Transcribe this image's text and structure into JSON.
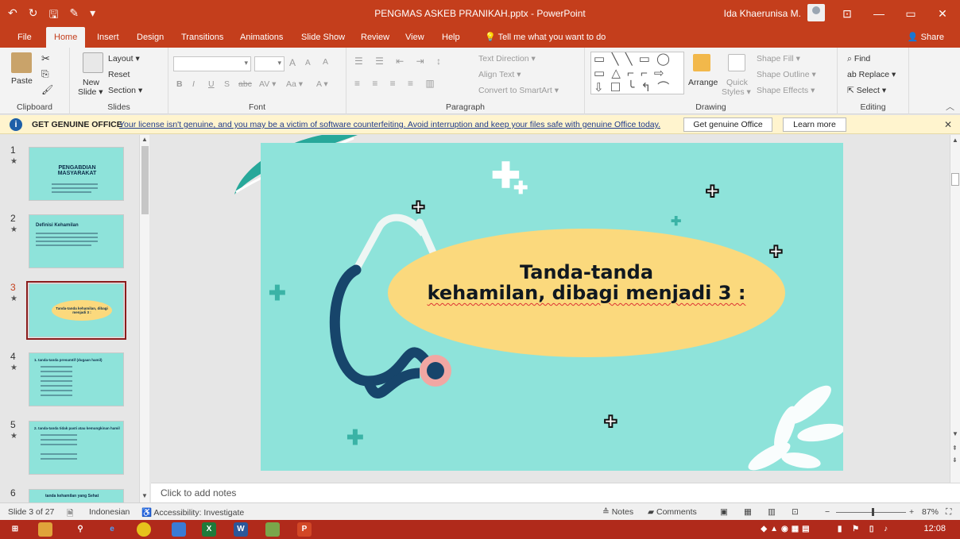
{
  "window": {
    "doc_title": "PENGMAS ASKEB PRANIKAH.pptx - PowerPoint",
    "user_name": "Ida Khaerunisa M.",
    "controls": {
      "minimize": "—",
      "restore": "▭",
      "close": "✕",
      "ribbon_display": "⊡"
    }
  },
  "qat": {
    "undo": "↶",
    "redo": "↻",
    "save": "🖫",
    "touch": "✎",
    "customize": "▾"
  },
  "tabs": [
    "File",
    "Home",
    "Insert",
    "Design",
    "Transitions",
    "Animations",
    "Slide Show",
    "Review",
    "View",
    "Help"
  ],
  "active_tab": "Home",
  "tell_me": "Tell me what you want to do",
  "share": "Share",
  "ribbon": {
    "clipboard": {
      "label": "Clipboard",
      "paste": "Paste"
    },
    "slides": {
      "label": "Slides",
      "new_slide": "New",
      "new_slide2": "Slide ▾",
      "layout": "Layout ▾",
      "reset": "Reset",
      "section": "Section ▾"
    },
    "font": {
      "label": "Font",
      "grow": "A",
      "shrink": "A",
      "clear": "A",
      "bold": "B",
      "italic": "I",
      "underline": "U",
      "shadow": "S",
      "strike": "abc",
      "spacing": "AV ▾",
      "case": "Aa ▾",
      "color": "A ▾"
    },
    "paragraph": {
      "label": "Paragraph",
      "text_direction": "Text Direction ▾",
      "align_text": "Align Text ▾",
      "smartart": "Convert to SmartArt ▾"
    },
    "drawing": {
      "label": "Drawing",
      "shapes": "▭ ╲ ╲ ▭ ◯ ▭ △ ⌐ ⌐ ⇨ ⇩ ☐ ╰ ↰ ⌒ { } ☆",
      "arrange": "Arrange",
      "quick_styles": "Quick",
      "quick_styles2": "Styles ▾",
      "shape_fill": "Shape Fill ▾",
      "shape_outline": "Shape Outline ▾",
      "shape_effects": "Shape Effects ▾"
    },
    "editing": {
      "label": "Editing",
      "find": "Find",
      "replace": "Replace ▾",
      "select": "Select ▾"
    }
  },
  "infobar": {
    "title": "GET GENUINE OFFICE",
    "message": "Your license isn't genuine, and you may be a victim of software counterfeiting. Avoid interruption and keep your files safe with genuine Office today.",
    "btn_genuine": "Get genuine Office",
    "btn_learn": "Learn more",
    "close": "✕"
  },
  "thumbnails": [
    {
      "num": "1",
      "title": "PENGABDIAN MASYARAKAT"
    },
    {
      "num": "2",
      "title": "Definisi Kehamilan"
    },
    {
      "num": "3",
      "title": "Tanda-tanda kehamilan, dibagi menjadi 3 :"
    },
    {
      "num": "4",
      "title": "1. tanda-tanda presumtif (dugaan hamil)"
    },
    {
      "num": "5",
      "title": "2. tanda-tanda tidak pasti atau kemungkinan hamil"
    },
    {
      "num": "6",
      "title": "tanda kehamilan yang Sehat"
    }
  ],
  "slide": {
    "title_line1": "Tanda-tanda",
    "title_line2": "kehamilan,  dibagi menjadi 3 :"
  },
  "notes_placeholder": "Click to add notes",
  "status": {
    "slide_of": "Slide 3 of 27",
    "language": "Indonesian",
    "accessibility": "Accessibility: Investigate",
    "notes": "Notes",
    "comments": "Comments",
    "zoom": "87%"
  },
  "taskbar": {
    "time": "12:08"
  },
  "colors": {
    "accent": "#c43e1c",
    "slide_bg": "#8ee3da",
    "oval": "#fbd97d",
    "navy": "#17456b"
  }
}
